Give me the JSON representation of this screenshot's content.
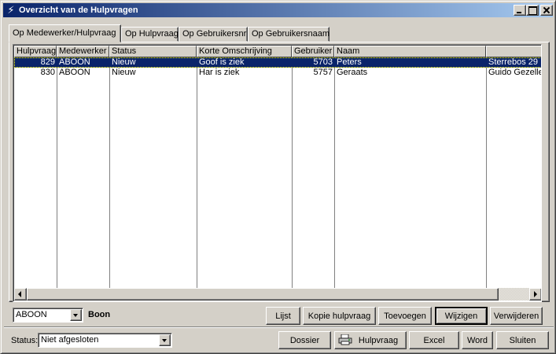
{
  "window": {
    "title": "Overzicht van de Hulpvragen"
  },
  "tabs": [
    {
      "label": "Op Medewerker/Hulpvraag",
      "active": true
    },
    {
      "label": "Op Hulpvraag",
      "active": false
    },
    {
      "label": "Op Gebruikersnr",
      "active": false
    },
    {
      "label": "Op Gebruikersnaam",
      "active": false
    }
  ],
  "grid": {
    "columns": [
      "Hulpvraag",
      "Medewerker",
      "Status",
      "Korte Omschrijving",
      "Gebruiker",
      "Naam",
      ""
    ],
    "rows": [
      {
        "hulpvraag": "829",
        "medewerker": "ABOON",
        "status": "Nieuw",
        "omschrijving": "Goof is ziek",
        "gebruiker": "5703",
        "naam": "Peters",
        "adres": "Sterrebos 29",
        "selected": true
      },
      {
        "hulpvraag": "830",
        "medewerker": "ABOON",
        "status": "Nieuw",
        "omschrijving": "Har is ziek",
        "gebruiker": "5757",
        "naam": "Geraats",
        "adres": "Guido Gezelle",
        "selected": false
      }
    ]
  },
  "medewerker": {
    "selected": "ABOON",
    "name": "Boon"
  },
  "actions": {
    "lijst": "Lijst",
    "kopie": "Kopie hulpvraag",
    "toevoegen": "Toevoegen",
    "wijzigen": "Wijzigen",
    "verwijderen": "Verwijderen"
  },
  "status": {
    "label": "Status:",
    "selected": "Niet afgesloten"
  },
  "bottom": {
    "dossier": "Dossier",
    "hulpvraag": "Hulpvraag",
    "excel": "Excel",
    "word": "Word",
    "sluiten": "Sluiten"
  },
  "icons": {
    "app": "app-icon",
    "printer": "printer-icon"
  },
  "colors": {
    "titlebar": "#0a246a",
    "selection": "#0a246a",
    "face": "#d4d0c8"
  }
}
